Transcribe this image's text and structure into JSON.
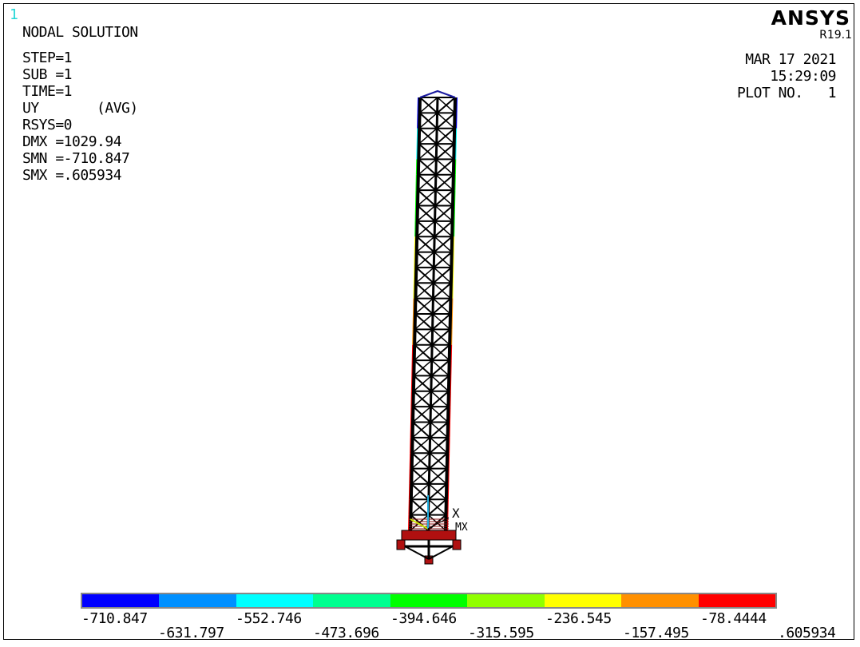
{
  "window_number": "1",
  "title": "NODAL SOLUTION",
  "info_lines": [
    "STEP=1",
    "SUB =1",
    "TIME=1",
    "UY       (AVG)",
    "RSYS=0",
    "DMX =1029.94",
    "SMN =-710.847",
    "SMX =.605934"
  ],
  "brand": "ANSYS",
  "revision": "R19.1",
  "date": "MAR 17 2021",
  "time": "15:29:09",
  "plot_no": "PLOT NO.   1",
  "triad_x_label": "X",
  "max_label": "MX",
  "legend": {
    "colors": [
      "#0000ff",
      "#0090ff",
      "#00ffff",
      "#00ff90",
      "#00ff00",
      "#90ff00",
      "#ffff00",
      "#ff9000",
      "#ff0000"
    ],
    "values": [
      "-710.847",
      "-631.797",
      "-552.746",
      "-473.696",
      "-394.646",
      "-315.595",
      "-236.545",
      "-157.495",
      "-78.4444",
      ".605934"
    ]
  }
}
